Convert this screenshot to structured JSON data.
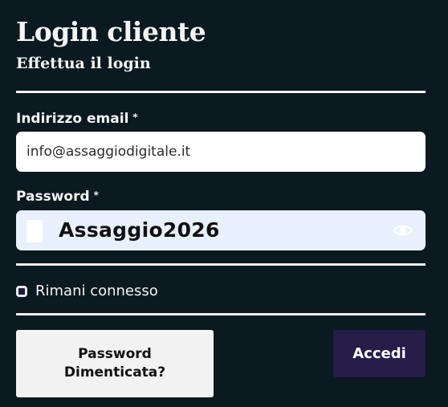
{
  "header": {
    "title": "Login cliente",
    "subtitle": "Effettua il login"
  },
  "form": {
    "email": {
      "label": "Indirizzo email",
      "required_mark": "*",
      "value": "info@assaggiodigitale.it"
    },
    "password": {
      "label": "Password",
      "required_mark": "*",
      "value": "Assaggio2026",
      "toggle_icon": "eye-icon"
    },
    "remember": {
      "label": "Rimani connesso",
      "checked": false
    }
  },
  "actions": {
    "forgot_label": "Password Dimenticata?",
    "login_label": "Accedi"
  },
  "colors": {
    "background": "#0b1a20",
    "primary_button": "#261d49",
    "secondary_button": "#f2f2f2",
    "password_autofill": "#e8f0fe"
  }
}
